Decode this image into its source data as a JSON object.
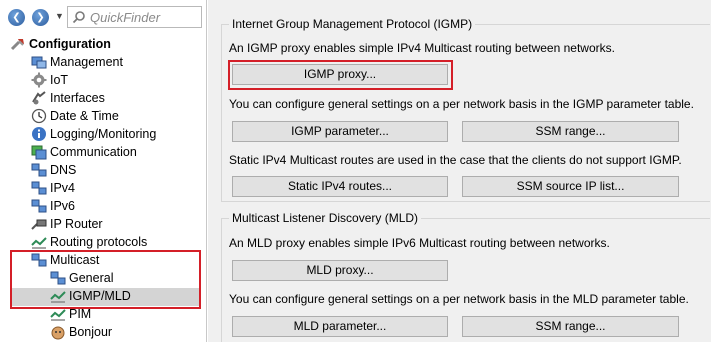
{
  "toolbar": {
    "search_placeholder": "QuickFinder"
  },
  "tree": {
    "root": "Configuration",
    "items": [
      {
        "label": "Management"
      },
      {
        "label": "IoT"
      },
      {
        "label": "Interfaces"
      },
      {
        "label": "Date & Time"
      },
      {
        "label": "Logging/Monitoring"
      },
      {
        "label": "Communication"
      },
      {
        "label": "DNS"
      },
      {
        "label": "IPv4"
      },
      {
        "label": "IPv6"
      },
      {
        "label": "IP Router"
      },
      {
        "label": "Routing protocols"
      },
      {
        "label": "Multicast"
      },
      {
        "label": "General"
      },
      {
        "label": "IGMP/MLD"
      },
      {
        "label": "PIM"
      },
      {
        "label": "Bonjour"
      }
    ]
  },
  "igmp": {
    "title": "Internet Group Management Protocol (IGMP)",
    "desc1": "An IGMP proxy enables simple IPv4 Multicast routing between networks.",
    "proxy_btn": "IGMP proxy...",
    "desc2": "You can configure general settings on a per network basis in the IGMP parameter table.",
    "param_btn": "IGMP parameter...",
    "ssm_btn": "SSM range...",
    "desc3": "Static IPv4 Multicast routes are used in the case that the clients do not support IGMP.",
    "static_btn": "Static IPv4 routes...",
    "ssm_src_btn": "SSM source IP list..."
  },
  "mld": {
    "title": "Multicast Listener Discovery (MLD)",
    "desc1": "An MLD proxy enables simple IPv6 Multicast routing between networks.",
    "proxy_btn": "MLD proxy...",
    "desc2": "You can configure general settings on a per network basis in the MLD parameter table.",
    "param_btn": "MLD parameter...",
    "ssm_btn": "SSM range..."
  },
  "colors": {
    "highlight_box": "#d41f28",
    "selection": "#d4d4d4",
    "panel_bg": "#f0f0f0"
  }
}
